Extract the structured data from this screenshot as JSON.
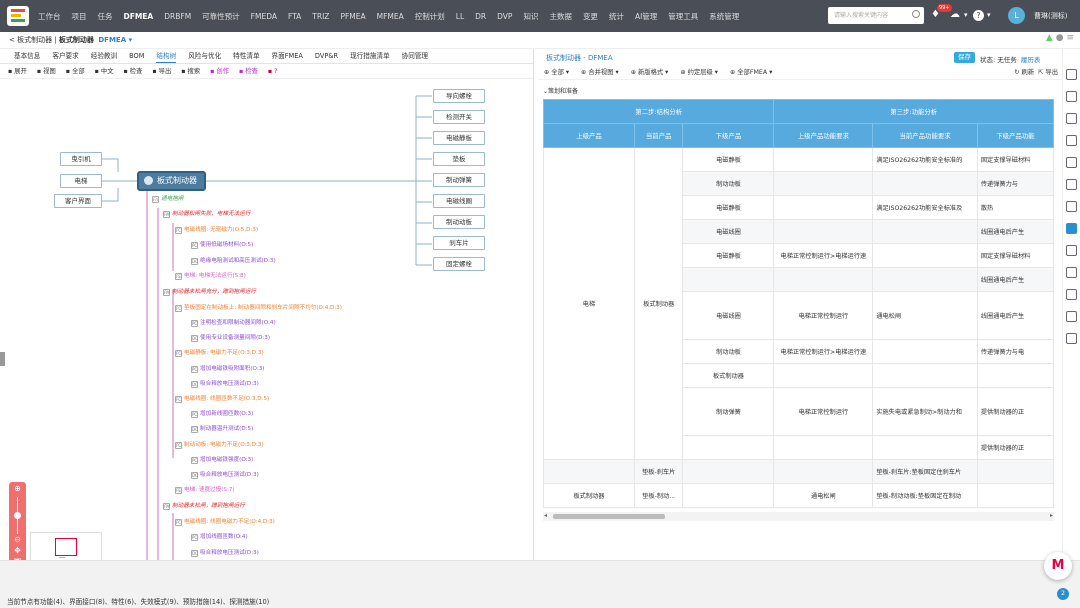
{
  "topbar": {
    "nav": [
      {
        "label": "工作台"
      },
      {
        "label": "项目"
      },
      {
        "label": "任务"
      },
      {
        "label": "DFMEA",
        "active": true
      },
      {
        "label": "DRBFM"
      },
      {
        "label": "可靠性预计"
      },
      {
        "label": "FMEDA"
      },
      {
        "label": "FTA"
      },
      {
        "label": "TRIZ"
      },
      {
        "label": "PFMEA"
      },
      {
        "label": "MFMEA"
      },
      {
        "label": "控制计划"
      },
      {
        "label": "LL"
      },
      {
        "label": "DR"
      },
      {
        "label": "DVP"
      },
      {
        "label": "知识"
      },
      {
        "label": "主数据"
      },
      {
        "label": "变更"
      },
      {
        "label": "统计"
      },
      {
        "label": "AI管理"
      },
      {
        "label": "管理工具"
      },
      {
        "label": "系统管理"
      }
    ],
    "search_placeholder": "请输入搜索关键内容",
    "notification_count": "99+",
    "help_label": "?",
    "avatar_letter": "L",
    "user_name": "曹琳(测标)"
  },
  "breadcrumb": {
    "back": "< 板式制动器",
    "separator": " | ",
    "current": "板式制动器",
    "module": "DFMEA"
  },
  "left": {
    "tabs": [
      {
        "label": "基本信息"
      },
      {
        "label": "客户要求"
      },
      {
        "label": "经验教训"
      },
      {
        "label": "BOM"
      },
      {
        "label": "结构树",
        "active": true
      },
      {
        "label": "风险与优化"
      },
      {
        "label": "特性清单"
      },
      {
        "label": "界面FMEA"
      },
      {
        "label": "DVP&R"
      },
      {
        "label": "现行措施清单"
      },
      {
        "label": "协同管理"
      }
    ],
    "toolbar": [
      {
        "label": "展开",
        "icon": "expand-icon"
      },
      {
        "label": "视图",
        "icon": "view-icon"
      },
      {
        "label": "全部",
        "icon": "filter-icon"
      },
      {
        "label": "中文",
        "icon": "language-icon"
      },
      {
        "label": "检查",
        "icon": "check-icon"
      },
      {
        "label": "导出",
        "icon": "export-icon"
      },
      {
        "label": "搜索",
        "icon": "search-icon"
      },
      {
        "label": "创作",
        "icon": "create-icon",
        "style": "hl"
      },
      {
        "label": "检查",
        "icon": "inspect-icon",
        "style": "hl"
      },
      {
        "label": "?",
        "icon": "help-icon",
        "style": "hl2"
      }
    ],
    "mindmap": {
      "root": "板式制动器",
      "interfaces": [
        "曳引机",
        "电梯",
        "客户界面"
      ],
      "parts": [
        "导向螺栓",
        "检测开关",
        "电磁静板",
        "垫板",
        "制动弹簧",
        "电磁线圈",
        "制动动板",
        "刹车片",
        "固定螺栓"
      ],
      "tree": [
        {
          "text": "通电抱闸",
          "color": "grn",
          "icon": "Fn"
        },
        {
          "text": "制动器松闸失败，电梯无法运行",
          "color": "red",
          "icon": "FM"
        },
        {
          "text": "电磁线圈: 无驱磁力(O:5,D:3)",
          "color": "org",
          "icon": "FC"
        },
        {
          "text": "使用低磁场材料(O:5)",
          "color": "pur",
          "icon": "PC"
        },
        {
          "text": "绝缘电阻测试和高压测试(D:3)",
          "color": "pur",
          "icon": "DC"
        },
        {
          "text": "电梯: 电梯无法运行(S:8)",
          "color": "pink",
          "icon": "FE"
        },
        {
          "text": "制动器未松闸充分，蹭到抱闸运行",
          "color": "red",
          "icon": "FM"
        },
        {
          "text": "垫板固定在制动板上: 制动器间隙和刹车片间隙不均匀(O:4,D:3)",
          "color": "org",
          "icon": "FC"
        },
        {
          "text": "注明检查和限制动器间隙(O:4)",
          "color": "pur",
          "icon": "PC"
        },
        {
          "text": "使用专业设备测量间隙(D:3)",
          "color": "pur",
          "icon": "DC"
        },
        {
          "text": "电磁静板: 电磁力不足(O:3,D:3)",
          "color": "org",
          "icon": "FC"
        },
        {
          "text": "增加电磁铁吸附面积(O:3)",
          "color": "pur",
          "icon": "PC"
        },
        {
          "text": "吸合释放电压测试(D:3)",
          "color": "pur",
          "icon": "DC"
        },
        {
          "text": "电磁线圈: 线圈匝数不足(O:3,D:5)",
          "color": "org",
          "icon": "FC"
        },
        {
          "text": "增加新线圈匝数(O:3)",
          "color": "pur",
          "icon": "PC"
        },
        {
          "text": "制动器温升测试(D:5)",
          "color": "pur",
          "icon": "DC"
        },
        {
          "text": "制动动板: 电磁力不足(O:3,D:3)",
          "color": "org",
          "icon": "FC"
        },
        {
          "text": "增加电磁铁强度(O:3)",
          "color": "pur",
          "icon": "PC"
        },
        {
          "text": "吸合释放电压测试(D:3)",
          "color": "pur",
          "icon": "DC"
        },
        {
          "text": "电梯: 速度过慢(S:7)",
          "color": "pink",
          "icon": "FE"
        },
        {
          "text": "制动器未松闸，蹭到抱闸运行",
          "color": "red",
          "icon": "FM"
        },
        {
          "text": "电磁线圈: 线圈电磁力不足(O:4,D:3)",
          "color": "org",
          "icon": "FC"
        },
        {
          "text": "增加线圈匝数(O:4)",
          "color": "pur",
          "icon": "PC"
        },
        {
          "text": "吸合释放电压测试(D:3)",
          "color": "pur",
          "icon": "DC"
        }
      ]
    }
  },
  "right": {
    "title": "板式制动器 - DFMEA",
    "save": "保存",
    "status_label": "状态:",
    "status_value": "无任务",
    "history": "履历表",
    "toolbar": [
      {
        "label": "全部"
      },
      {
        "label": "合并视图"
      },
      {
        "label": "新版格式"
      },
      {
        "label": "约定层级"
      },
      {
        "label": "全部FMEA"
      }
    ],
    "toolbar_right": [
      "刷新",
      "导出"
    ],
    "prep_label": "策划和准备",
    "table": {
      "group_headers": [
        "第二步:结构分析",
        "第三步:功能分析"
      ],
      "columns": [
        "上级产品",
        "当前产品",
        "下级产品",
        "上级产品功能要求",
        "当前产品功能要求",
        "下级产品功能"
      ],
      "rows": [
        {
          "lower": "电磁静板",
          "cur_func": "满足ISO26262功能安全标准的",
          "lower_func": "固定支撑导磁材料"
        },
        {
          "lower": "制动动板",
          "lower_func": "传递弹簧力与"
        },
        {
          "lower": "电磁静板",
          "cur_func": "满足ISO26262功能安全标准及",
          "lower_func": "散热"
        },
        {
          "lower": "电磁线圈",
          "lower_func": "线圈通电后产生"
        },
        {
          "lower": "电磁静板",
          "upper_func": "电梯正常控制运行>电梯运行速",
          "lower_func": "固定支撑导磁材料"
        },
        {
          "lower": "",
          "lower_func": "线圈通电后产生"
        },
        {
          "lower": "电磁线圈",
          "upper_func": "电梯正常控制运行",
          "cur_func": "通电松闸",
          "lower_func": "线圈通电后产生"
        },
        {
          "lower": "制动动板",
          "upper_func": "电梯正常控制运行>电梯运行速",
          "lower_func": "传递弹簧力与电"
        },
        {
          "lower": "板式制动器"
        },
        {
          "lower": "制动弹簧",
          "upper_func": "电梯正常控制运行",
          "cur_func": "实施失电或紧急制动>制动力和",
          "lower_func": "提供制动器的正"
        },
        {
          "lower": "",
          "lower_func": "提供制动器的正"
        },
        {
          "current": "垫板-刹车片",
          "cur_func": "垫板-刹车片:垫板固定住刹车片"
        },
        {
          "upper": "板式制动器",
          "current": "垫板-制动...",
          "upper_func": "通电松闸",
          "cur_func": "垫板-制动动板:垫板固定在制动"
        }
      ],
      "upper_product": "电梯",
      "current_product": "板式制动器"
    }
  },
  "footer": {
    "summary": "当前节点有功能(4)、界面接口(8)、特性(6)、失效模式(9)、预防措施(14)、探测措施(10)",
    "corner_badge": "2",
    "chat_logo": "M"
  },
  "colors": {
    "topbar": "#4a4f57",
    "header_blue": "#56aadd",
    "accent": "#2f80c4",
    "node_root": "#4e7c9e",
    "zoom_red": "#ef6f6f"
  }
}
